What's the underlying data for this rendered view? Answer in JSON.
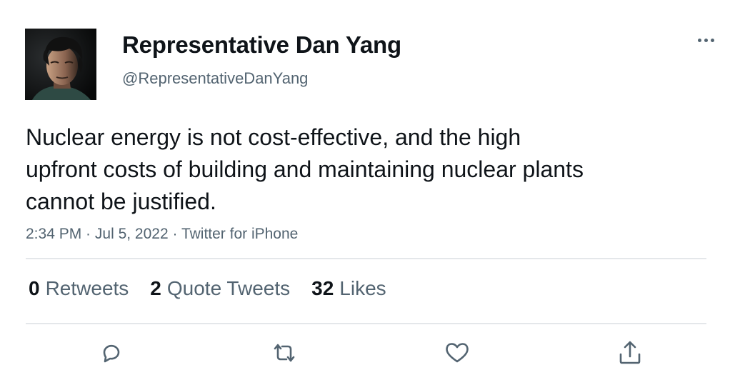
{
  "user": {
    "display_name": "Representative Dan Yang",
    "handle": "@RepresentativeDanYang",
    "avatar_icon": "profile-photo"
  },
  "tweet": {
    "text": "Nuclear energy is not cost-effective, and the high upfront costs of building and maintaining nuclear plants cannot be justified.",
    "time": "2:34 PM",
    "date": "Jul 5, 2022",
    "source": "Twitter for iPhone",
    "meta_separator": " · "
  },
  "stats": {
    "retweets_count": "0",
    "retweets_label": "Retweets",
    "quotes_count": "2",
    "quotes_label": "Quote Tweets",
    "likes_count": "32",
    "likes_label": "Likes"
  },
  "actions": {
    "reply_icon": "reply-icon",
    "retweet_icon": "retweet-icon",
    "like_icon": "heart-icon",
    "share_icon": "share-icon"
  },
  "colors": {
    "text_primary": "#0f1419",
    "text_secondary": "#536471",
    "divider": "#e4e7ea"
  }
}
